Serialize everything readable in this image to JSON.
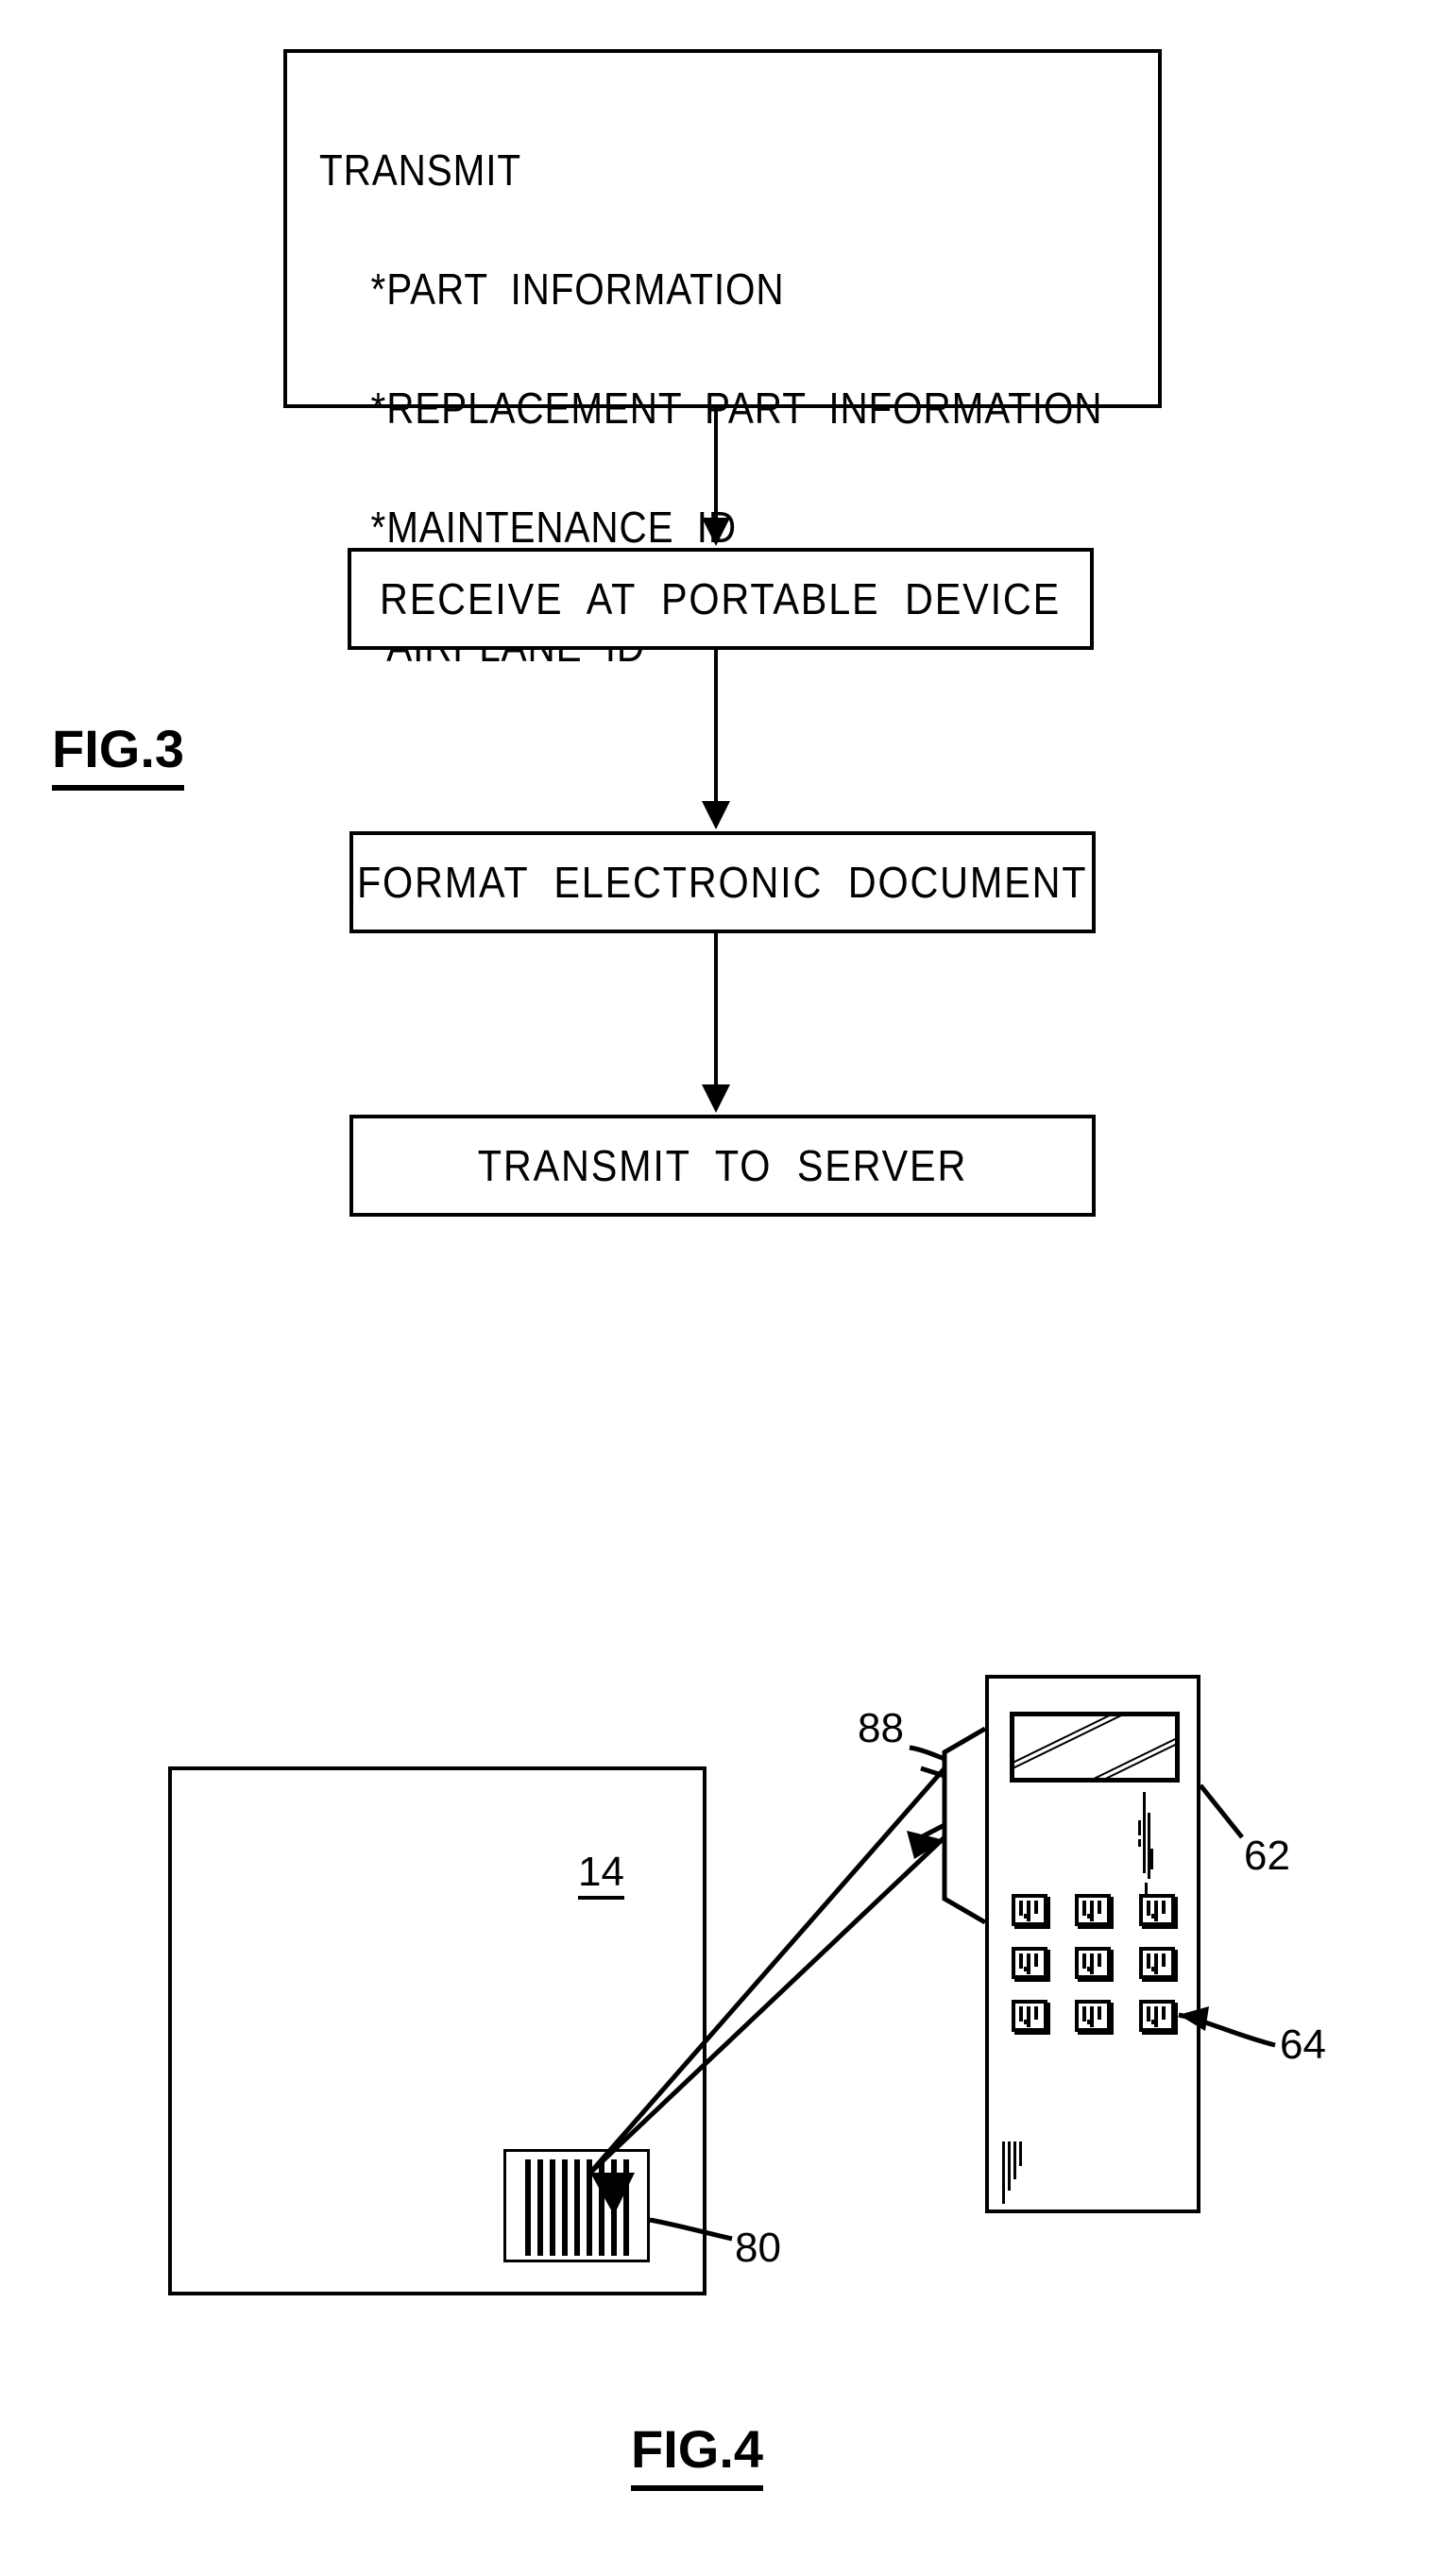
{
  "document": {
    "type": "patent-figure-sheet",
    "figures": [
      "FIG.3",
      "FIG.4"
    ]
  },
  "fig3": {
    "caption": "FIG.3",
    "boxes": [
      {
        "id": "transmit",
        "lines": [
          "TRANSMIT",
          "*PART  INFORMATION",
          "*REPLACEMENT  PART  INFORMATION",
          "*MAINTENANCE  ID",
          "*AIRPLANE  ID"
        ]
      },
      {
        "id": "receive",
        "label": "RECEIVE  AT  PORTABLE  DEVICE"
      },
      {
        "id": "format",
        "label": "FORMAT  ELECTRONIC  DOCUMENT"
      },
      {
        "id": "server",
        "label": "TRANSMIT  TO  SERVER"
      }
    ],
    "flow_order": [
      "TRANSMIT",
      "RECEIVE  AT  PORTABLE  DEVICE",
      "FORMAT  ELECTRONIC  DOCUMENT",
      "TRANSMIT  TO  SERVER"
    ]
  },
  "fig4": {
    "caption": "FIG.4",
    "reference_numerals": {
      "panel": "14",
      "display": "88",
      "device": "62",
      "keypad_key": "64",
      "barcode": "80"
    },
    "labels": [
      {
        "text": "14",
        "refers_to": "placard-or-panel",
        "underlined": true
      },
      {
        "text": "88",
        "refers_to": "scan-beam-display"
      },
      {
        "text": "62",
        "refers_to": "portable-handheld-device"
      },
      {
        "text": "64",
        "refers_to": "keypad-button"
      },
      {
        "text": "80",
        "refers_to": "barcode-label"
      }
    ],
    "device": {
      "screen": "display",
      "keypad_rows": 3,
      "keypad_cols": 3,
      "key_count": 9
    },
    "barcode": {
      "bar_count": 9
    }
  },
  "colors": {
    "ink": "#000000",
    "paper": "#ffffff"
  }
}
